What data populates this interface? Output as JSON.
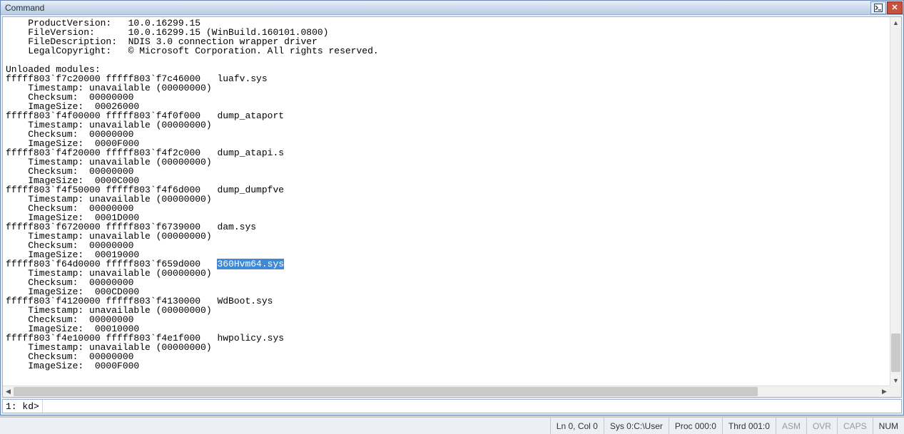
{
  "window": {
    "title": "Command"
  },
  "output": {
    "header": [
      "    ProductVersion:   10.0.16299.15",
      "    FileVersion:      10.0.16299.15 (WinBuild.160101.0800)",
      "    FileDescription:  NDIS 3.0 connection wrapper driver",
      "    LegalCopyright:   © Microsoft Corporation. All rights reserved.",
      ""
    ],
    "unloaded_title": "Unloaded modules:",
    "modules": [
      {
        "range": "fffff803`f7c20000 fffff803`f7c46000",
        "name": "luafv.sys",
        "timestamp": "unavailable (00000000)",
        "checksum": "00000000",
        "imagesize": "00026000",
        "highlighted": false
      },
      {
        "range": "fffff803`f4f00000 fffff803`f4f0f000",
        "name": "dump_ataport",
        "timestamp": "unavailable (00000000)",
        "checksum": "00000000",
        "imagesize": "0000F000",
        "highlighted": false
      },
      {
        "range": "fffff803`f4f20000 fffff803`f4f2c000",
        "name": "dump_atapi.s",
        "timestamp": "unavailable (00000000)",
        "checksum": "00000000",
        "imagesize": "0000C000",
        "highlighted": false
      },
      {
        "range": "fffff803`f4f50000 fffff803`f4f6d000",
        "name": "dump_dumpfve",
        "timestamp": "unavailable (00000000)",
        "checksum": "00000000",
        "imagesize": "0001D000",
        "highlighted": false
      },
      {
        "range": "fffff803`f6720000 fffff803`f6739000",
        "name": "dam.sys",
        "timestamp": "unavailable (00000000)",
        "checksum": "00000000",
        "imagesize": "00019000",
        "highlighted": false
      },
      {
        "range": "fffff803`f64d0000 fffff803`f659d000",
        "name": "360Hvm64.sys",
        "timestamp": "unavailable (00000000)",
        "checksum": "00000000",
        "imagesize": "000CD000",
        "highlighted": true
      },
      {
        "range": "fffff803`f4120000 fffff803`f4130000",
        "name": "WdBoot.sys",
        "timestamp": "unavailable (00000000)",
        "checksum": "00000000",
        "imagesize": "00010000",
        "highlighted": false
      },
      {
        "range": "fffff803`f4e10000 fffff803`f4e1f000",
        "name": "hwpolicy.sys",
        "timestamp": "unavailable (00000000)",
        "checksum": "00000000",
        "imagesize": "0000F000",
        "highlighted": false
      }
    ]
  },
  "prompt": {
    "label": "1: kd>",
    "value": ""
  },
  "status": {
    "lncol": "Ln 0, Col 0",
    "sys": "Sys 0:C:\\User",
    "proc": "Proc 000:0",
    "thrd": "Thrd 001:0",
    "asm": "ASM",
    "ovr": "OVR",
    "caps": "CAPS",
    "num": "NUM"
  }
}
